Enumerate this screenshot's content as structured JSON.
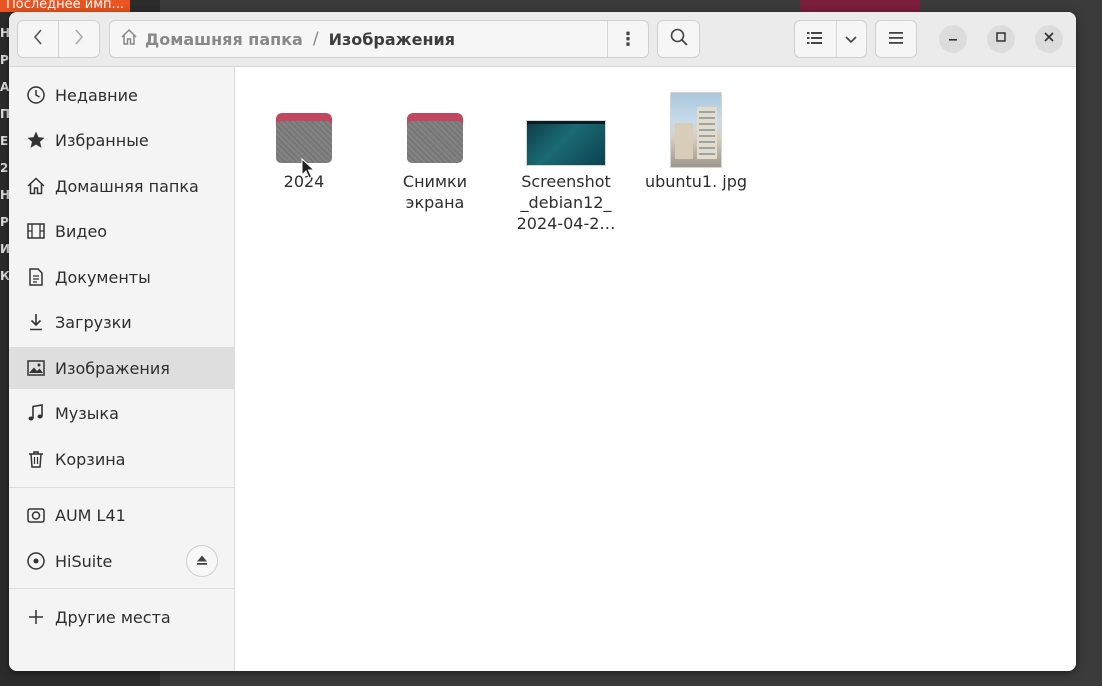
{
  "background": {
    "tab_text": "Последнее имп...",
    "letters": [
      "Н",
      "Р",
      "А",
      "П",
      "Е",
      "2",
      "Н",
      "Р",
      "И",
      "К"
    ]
  },
  "header": {
    "path_home": "Домашняя папка",
    "path_separator": "/",
    "path_current": "Изображения"
  },
  "sidebar": {
    "places": [
      {
        "label": "Недавние",
        "icon": "clock-icon"
      },
      {
        "label": "Избранные",
        "icon": "star-icon"
      },
      {
        "label": "Домашняя папка",
        "icon": "home-icon"
      },
      {
        "label": "Видео",
        "icon": "video-icon"
      },
      {
        "label": "Документы",
        "icon": "document-icon"
      },
      {
        "label": "Загрузки",
        "icon": "download-icon"
      },
      {
        "label": "Изображения",
        "icon": "image-icon",
        "active": true
      },
      {
        "label": "Музыка",
        "icon": "music-icon"
      },
      {
        "label": "Корзина",
        "icon": "trash-icon"
      }
    ],
    "devices": [
      {
        "label": "AUM L41",
        "icon": "camera-icon"
      },
      {
        "label": "HiSuite",
        "icon": "disc-icon"
      }
    ],
    "other": {
      "label": "Другие места",
      "icon": "plus-icon"
    }
  },
  "files": [
    {
      "name": "2024",
      "type": "folder"
    },
    {
      "name": "Снимки экрана",
      "type": "folder"
    },
    {
      "name": "Screenshot _debian12_ 2024-04-2…",
      "type": "screenshot"
    },
    {
      "name": "ubuntu1. jpg",
      "type": "photo"
    }
  ],
  "colors": {
    "folder_tab": "#c1465f",
    "folder_body": "#7c7c7c",
    "accent_orange": "#e95420"
  }
}
